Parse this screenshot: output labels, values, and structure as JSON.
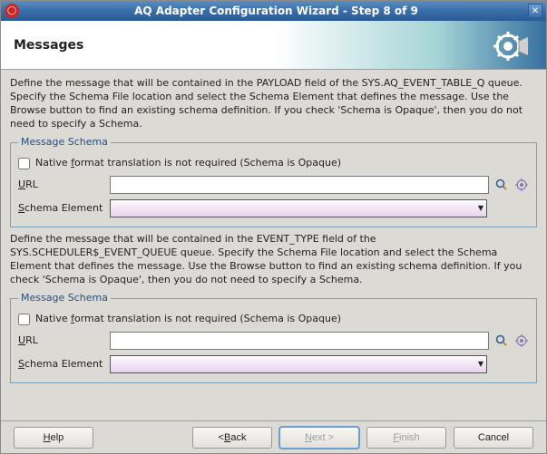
{
  "window": {
    "title": "AQ Adapter Configuration Wizard - Step 8 of 9"
  },
  "header": {
    "heading": "Messages"
  },
  "section1": {
    "description": "Define the message that will be contained in the PAYLOAD field of the SYS.AQ_EVENT_TABLE_Q queue. Specify the Schema File location and select the Schema Element that defines the message. Use the Browse button to find an existing schema definition. If you check 'Schema is Opaque', then you do not need to specify a Schema.",
    "legend": "Message Schema",
    "checkbox_label_pre": "Native ",
    "checkbox_label_u": "f",
    "checkbox_label_post": "ormat translation is not required (Schema is Opaque)",
    "url_label_u": "U",
    "url_label_post": "RL",
    "url_value": "",
    "schema_label_u": "S",
    "schema_label_post": "chema Element",
    "schema_value": ""
  },
  "section2": {
    "description": "Define the message that will be contained in the EVENT_TYPE field of the SYS.SCHEDULER$_EVENT_QUEUE queue.  Specify the Schema File location and select the Schema Element that defines the message. Use the Browse button to find an existing schema definition. If you check 'Schema is Opaque', then you do not need to specify a Schema.",
    "legend": "Message Schema",
    "checkbox_label_pre": "Native ",
    "checkbox_label_u": "f",
    "checkbox_label_post": "ormat translation is not required (Schema is Opaque)",
    "url_label_u": "U",
    "url_label_post": "RL",
    "url_value": "",
    "schema_label_u": "S",
    "schema_label_post": "chema Element",
    "schema_value": ""
  },
  "buttons": {
    "help_u": "H",
    "help_post": "elp",
    "back_pre": "< ",
    "back_u": "B",
    "back_post": "ack",
    "next_u": "N",
    "next_post": "ext >",
    "finish_u": "F",
    "finish_post": "inish",
    "cancel": "Cancel"
  }
}
